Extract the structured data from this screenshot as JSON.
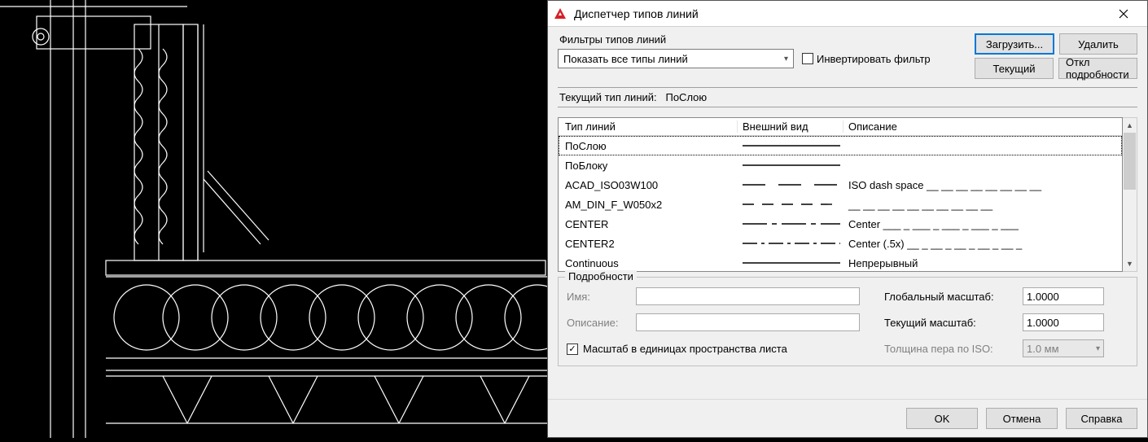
{
  "window": {
    "title": "Диспетчер типов линий"
  },
  "filter": {
    "group_label": "Фильтры типов линий",
    "dropdown_value": "Показать все типы линий",
    "invert_label": "Инвертировать фильтр"
  },
  "buttons": {
    "load": "Загрузить...",
    "delete": "Удалить",
    "current": "Текущий",
    "toggle_details": "Откл подробности",
    "ok": "OK",
    "cancel": "Отмена",
    "help": "Справка"
  },
  "current_linetype": {
    "label": "Текущий тип линий:",
    "value": "ПоСлою"
  },
  "columns": {
    "name": "Тип линий",
    "preview": "Внешний вид",
    "description": "Описание"
  },
  "rows": [
    {
      "name": "ПоСлою",
      "preview": "solid",
      "description": ""
    },
    {
      "name": "ПоБлоку",
      "preview": "solid",
      "description": ""
    },
    {
      "name": "ACAD_ISO03W100",
      "preview": "longdash",
      "description": "ISO dash space __ __ __ __ __ __ __ __"
    },
    {
      "name": "AM_DIN_F_W050x2",
      "preview": "mediumdash",
      "description": "__ __ __ __ __ __ __ __ __ __"
    },
    {
      "name": "CENTER",
      "preview": "center",
      "description": "Center ___ _ ___ _ ___ _ ___ _ ___"
    },
    {
      "name": "CENTER2",
      "preview": "center2",
      "description": "Center (.5x) __ _ __ _ __ _ __ _ __ _"
    },
    {
      "name": "Continuous",
      "preview": "solid",
      "description": "Непрерывный"
    }
  ],
  "details": {
    "title": "Подробности",
    "name_label": "Имя:",
    "name_value": "",
    "desc_label": "Описание:",
    "desc_value": "",
    "paperspace_label": "Масштаб в единицах пространства листа",
    "global_scale_label": "Глобальный масштаб:",
    "global_scale_value": "1.0000",
    "current_scale_label": "Текущий масштаб:",
    "current_scale_value": "1.0000",
    "iso_pen_label": "Толщина пера по ISO:",
    "iso_pen_value": "1.0 мм"
  }
}
